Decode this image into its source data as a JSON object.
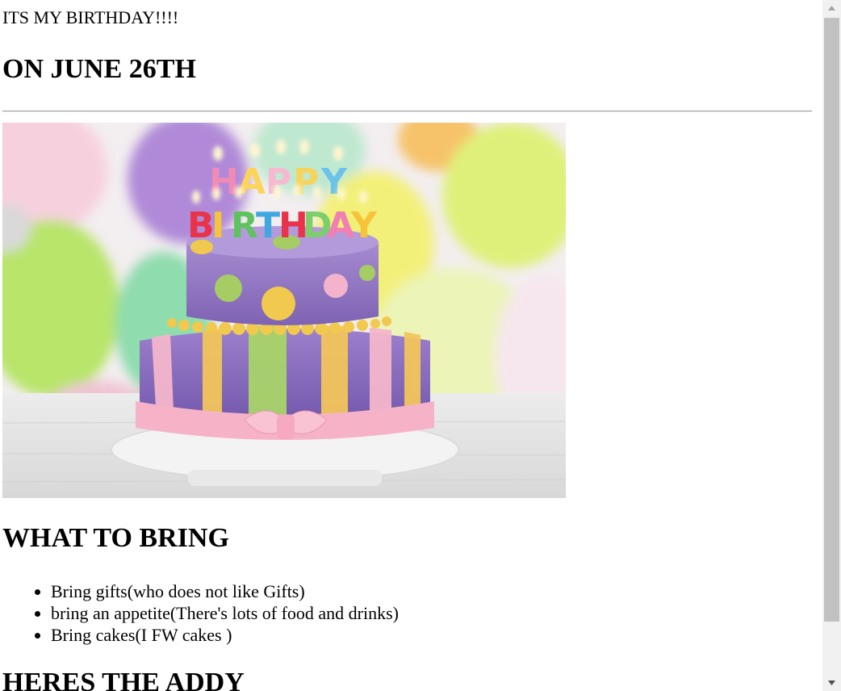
{
  "page": {
    "intro_text": "ITS MY BIRTHDAY!!!!",
    "date_heading": "ON JUNE 26TH",
    "image": {
      "name": "birthday-cake",
      "candle_text_top": "HAPPY",
      "candle_text_bottom": "BIRTHDAY"
    },
    "bring_heading": "WHAT TO BRING",
    "bring_items": [
      "Bring gifts(who does not like Gifts)",
      "bring an appetite(There's lots of food and drinks)",
      "Bring cakes(I FW cakes )"
    ],
    "address_heading": "HERES THE ADDY"
  },
  "scrollbar": {
    "up_icon": "triangle-up-icon",
    "down_icon": "triangle-down-icon"
  }
}
